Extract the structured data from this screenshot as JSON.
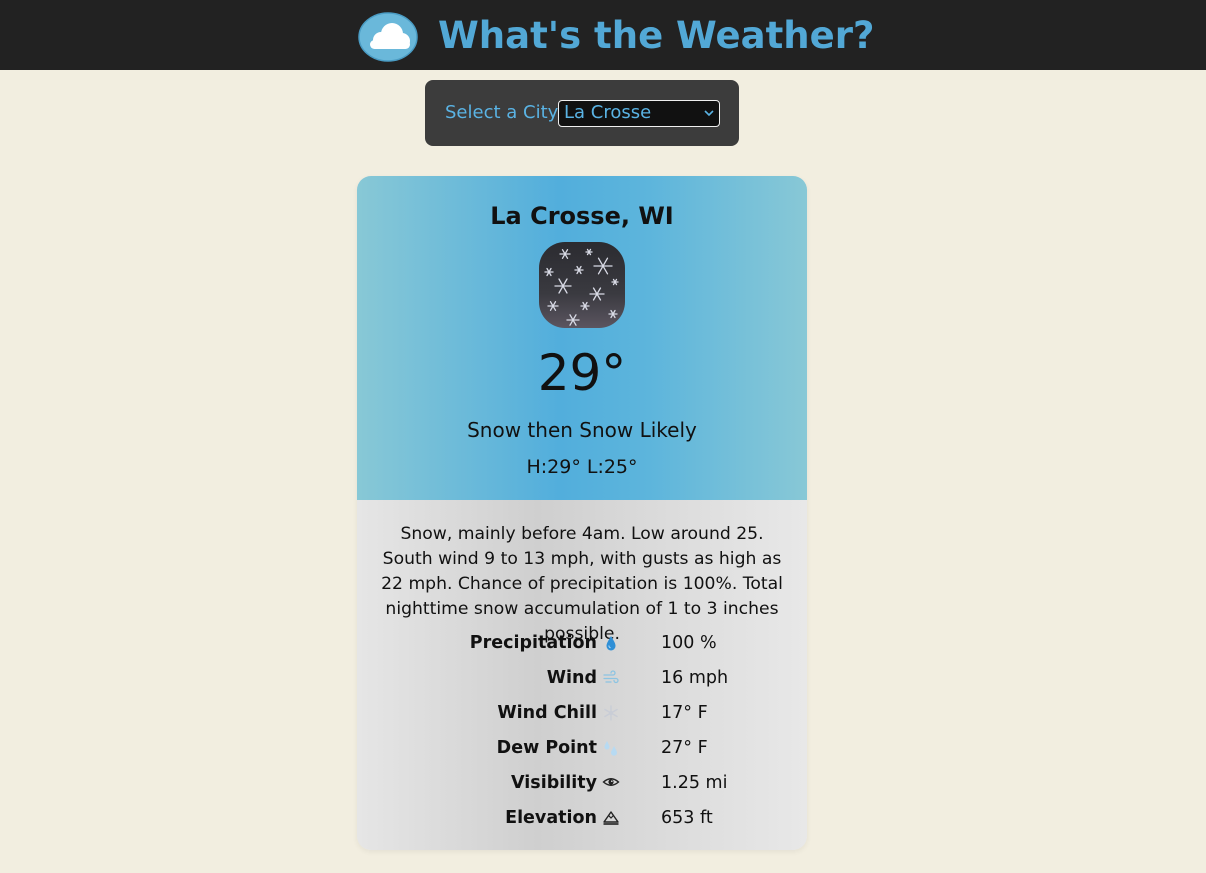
{
  "header": {
    "title": "What's the Weather?",
    "logo_icon": "cloud-icon"
  },
  "city_picker": {
    "label": "Select a City:",
    "selected": "La Crosse"
  },
  "forecast": {
    "location": "La Crosse, WI",
    "condition_icon": "snow-icon",
    "temperature": "29°",
    "short_forecast": "Snow then Snow Likely",
    "high_low": "H:29° L:25°",
    "detailed_forecast": "Snow, mainly before 4am. Low around 25. South wind 9 to 13 mph, with gusts as high as 22 mph. Chance of precipitation is 100%. Total nighttime snow accumulation of 1 to 3 inches possible."
  },
  "stats": [
    {
      "label": "Precipitation",
      "icon": "raindrop-icon",
      "value": "100 %"
    },
    {
      "label": "Wind",
      "icon": "wind-icon",
      "value": "16 mph"
    },
    {
      "label": "Wind Chill",
      "icon": "snowflake-icon",
      "value": "17° F"
    },
    {
      "label": "Dew Point",
      "icon": "droplets-icon",
      "value": "27° F"
    },
    {
      "label": "Visibility",
      "icon": "eye-icon",
      "value": "1.25 mi"
    },
    {
      "label": "Elevation",
      "icon": "mountain-icon",
      "value": "653 ft"
    }
  ],
  "colors": {
    "accent": "#52a8d6",
    "header_bg": "#222222",
    "page_bg": "#f2eee0"
  }
}
